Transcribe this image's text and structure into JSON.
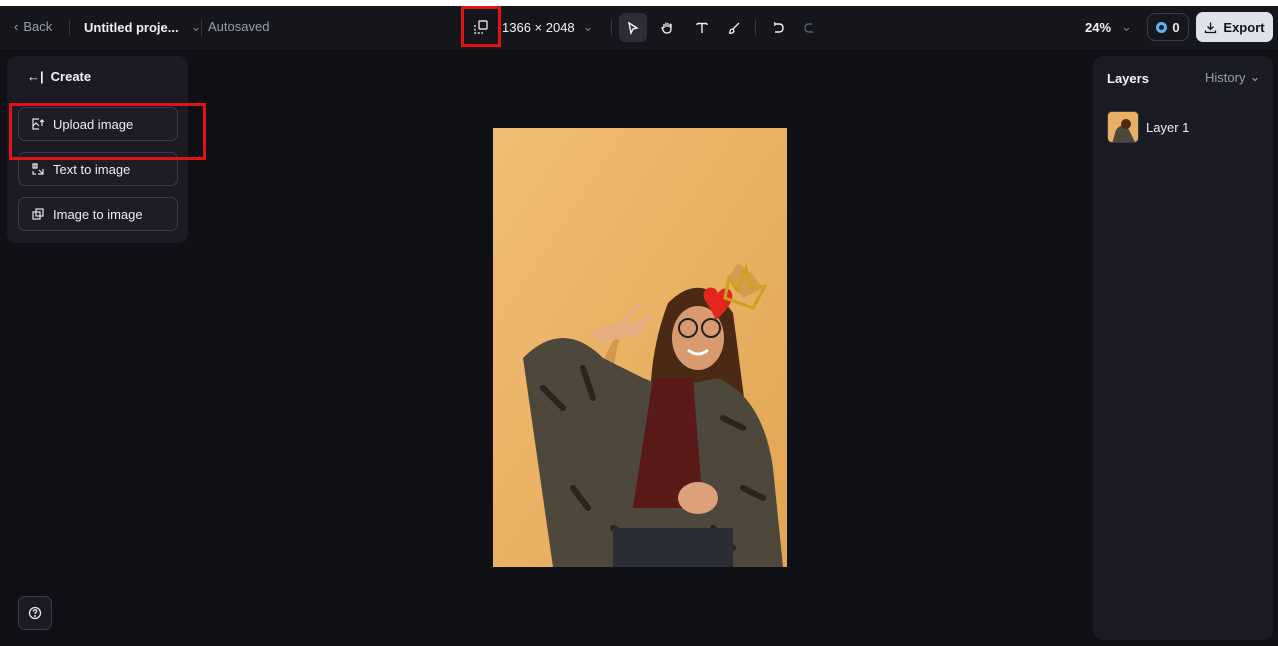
{
  "topbar": {
    "back_label": "Back",
    "project_name": "Untitled proje...",
    "autosave_status": "Autosaved",
    "canvas_size": "1366 × 2048",
    "zoom": "24%",
    "credits": "0",
    "export_label": "Export"
  },
  "tools": [
    "select-tool",
    "hand-tool",
    "text-tool",
    "brush-tool",
    "undo",
    "redo"
  ],
  "create_panel": {
    "title": "Create",
    "items": [
      {
        "label": "Upload image",
        "icon": "upload-image-icon"
      },
      {
        "label": "Text to image",
        "icon": "text-to-image-icon"
      },
      {
        "label": "Image to image",
        "icon": "image-to-image-icon"
      }
    ]
  },
  "layers_panel": {
    "title": "Layers",
    "history_label": "History",
    "layers": [
      {
        "name": "Layer 1"
      }
    ]
  },
  "colors": {
    "background": "#101116",
    "panel": "#1b1c23",
    "highlight": "#e01414",
    "export_bg": "#dfe2ea",
    "photo_wall": "#eab468"
  }
}
